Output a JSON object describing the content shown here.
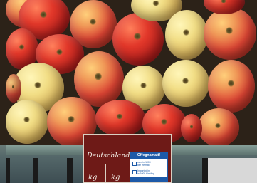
{
  "photo": {
    "description_colors": {
      "red_apple": "#d83528",
      "yellow_apple": "#f0d27a",
      "crate": "#55686a"
    }
  },
  "sign": {
    "country": "Deutschland",
    "unit_left": "kg",
    "unit_right": "kg"
  },
  "sticker": {
    "title": "Offegnamatt!",
    "line1": "nam in 1000",
    "line2": "der Heimat",
    "line3": "Imported in",
    "line4": "in 1000 Kiesling"
  }
}
